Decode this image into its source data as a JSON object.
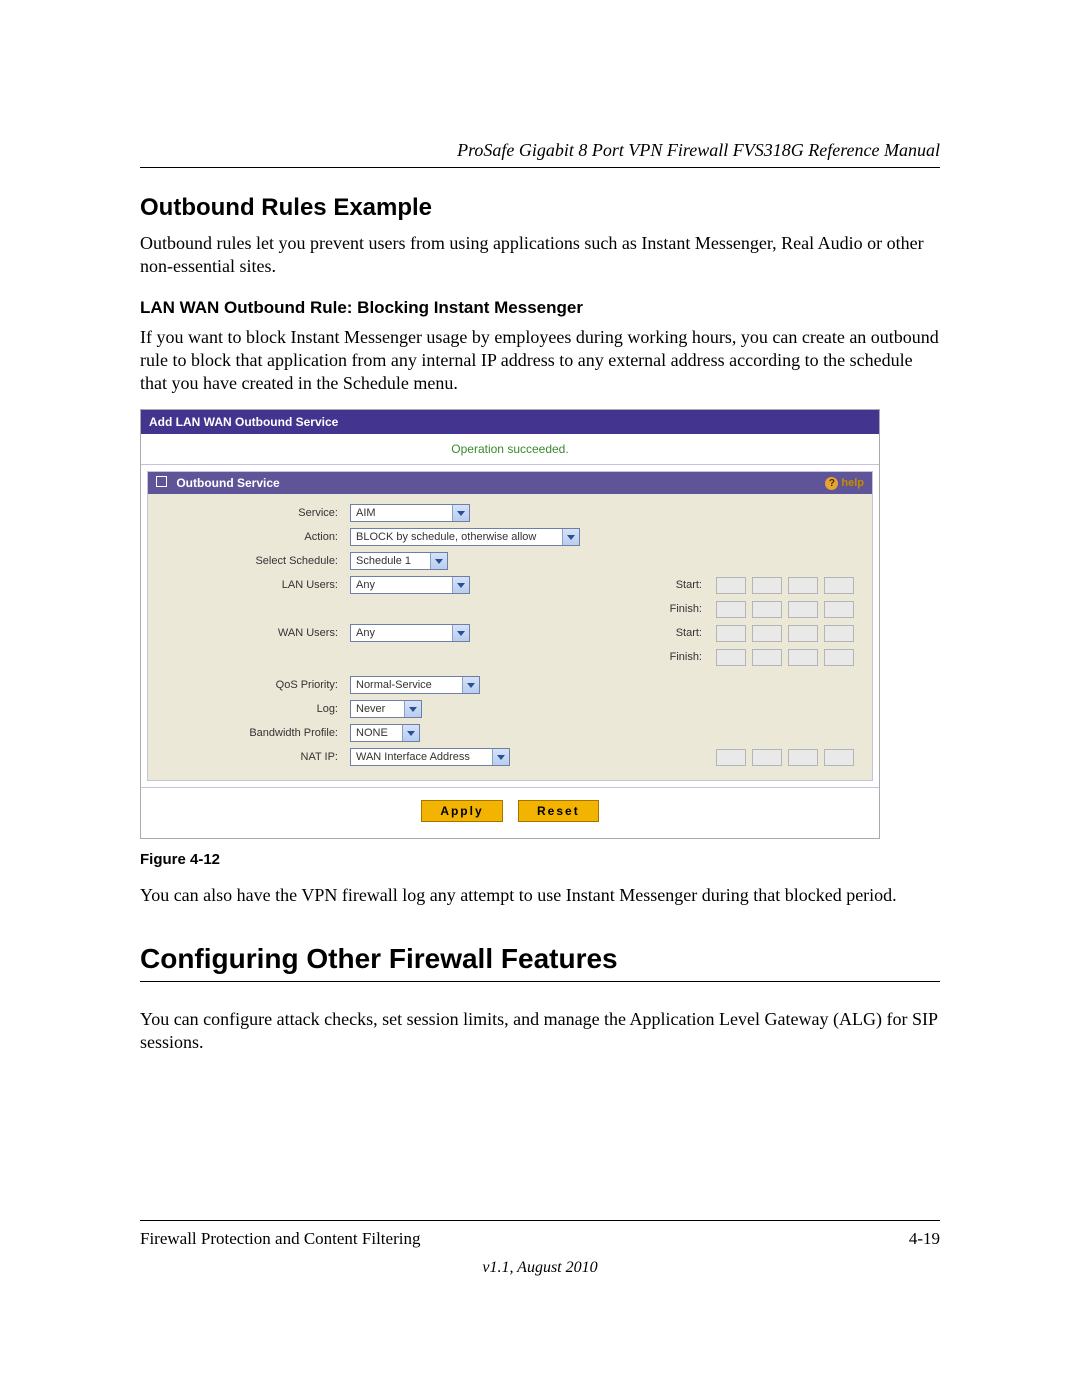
{
  "doc_header": "ProSafe Gigabit 8 Port VPN Firewall FVS318G Reference Manual",
  "h2_outbound": "Outbound Rules Example",
  "p_outbound_intro": "Outbound rules let you prevent users from using applications such as Instant Messenger, Real Audio or other non-essential sites.",
  "h3_lanwan": "LAN WAN Outbound Rule: Blocking Instant Messenger",
  "p_lanwan_body": "If you want to block Instant Messenger usage by employees during working hours, you can create an outbound rule to block that application from any internal IP address to any external address according to the schedule that you have created in the Schedule menu.",
  "fig_caption": "Figure 4-12",
  "p_after_fig": "You can also have the VPN firewall log any attempt to use Instant Messenger during that blocked period.",
  "h1_other": "Configuring Other Firewall Features",
  "p_other_body": "You can configure attack checks, set session limits, and manage the Application Level Gateway (ALG) for SIP sessions.",
  "footer_left": "Firewall Protection and Content Filtering",
  "footer_right": "4-19",
  "footer_version": "v1.1, August 2010",
  "shot": {
    "title": "Add LAN WAN Outbound Service",
    "status": "Operation succeeded.",
    "box_title": "Outbound Service",
    "help_label": "help",
    "labels": {
      "service": "Service:",
      "action": "Action:",
      "schedule": "Select Schedule:",
      "lan": "LAN Users:",
      "wan": "WAN Users:",
      "qos": "QoS Priority:",
      "log": "Log:",
      "bw": "Bandwidth Profile:",
      "nat": "NAT IP:",
      "start": "Start:",
      "finish": "Finish:"
    },
    "values": {
      "service": "AIM",
      "action": "BLOCK by schedule, otherwise allow",
      "schedule": "Schedule 1",
      "lan": "Any",
      "wan": "Any",
      "qos": "Normal-Service",
      "log": "Never",
      "bw": "NONE",
      "nat": "WAN Interface Address"
    },
    "buttons": {
      "apply": "Apply",
      "reset": "Reset"
    }
  }
}
